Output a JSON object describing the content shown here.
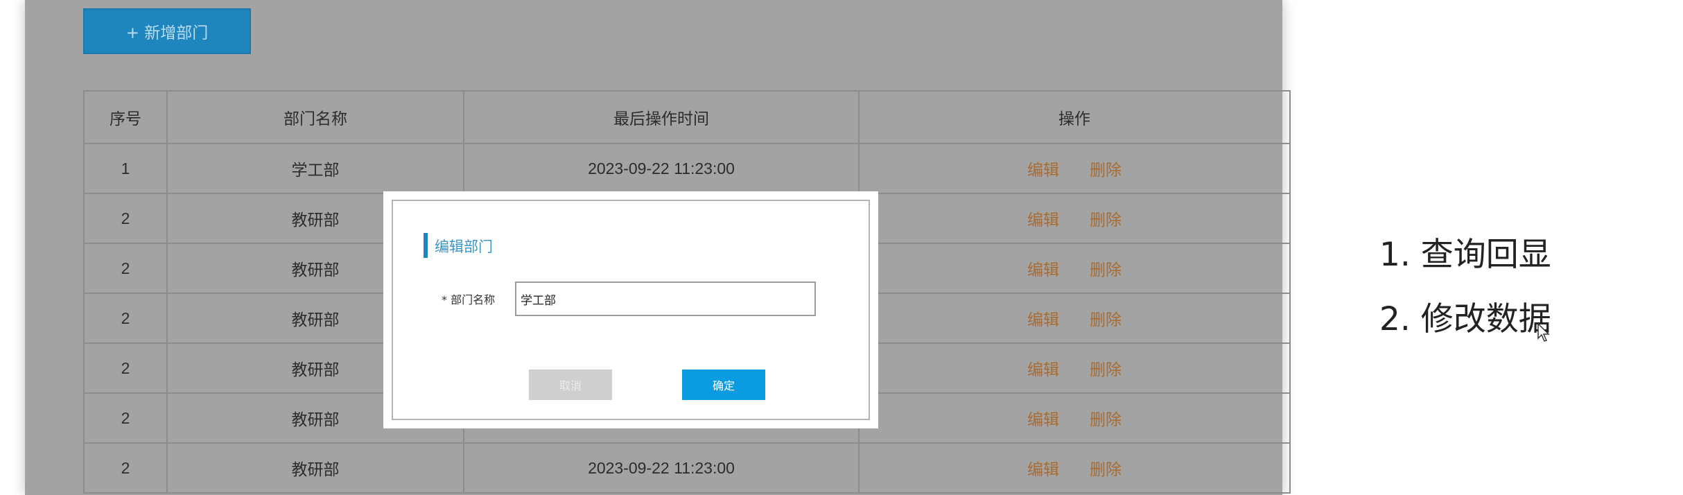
{
  "toolbar": {
    "add_label": "+ 新增部门"
  },
  "table": {
    "headers": [
      "序号",
      "部门名称",
      "最后操作时间",
      "操作"
    ],
    "rows": [
      {
        "index": "1",
        "name": "学工部",
        "time": "2023-09-22 11:23:00",
        "edit": "编辑",
        "delete": "删除"
      },
      {
        "index": "2",
        "name": "教研部",
        "time": "",
        "edit": "编辑",
        "delete": "删除"
      },
      {
        "index": "2",
        "name": "教研部",
        "time": "",
        "edit": "编辑",
        "delete": "删除"
      },
      {
        "index": "2",
        "name": "教研部",
        "time": "",
        "edit": "编辑",
        "delete": "删除"
      },
      {
        "index": "2",
        "name": "教研部",
        "time": "",
        "edit": "编辑",
        "delete": "删除"
      },
      {
        "index": "2",
        "name": "教研部",
        "time": "",
        "edit": "编辑",
        "delete": "删除"
      },
      {
        "index": "2",
        "name": "教研部",
        "time": "2023-09-22 11:23:00",
        "edit": "编辑",
        "delete": "删除"
      }
    ]
  },
  "dialog": {
    "title": "编辑部门",
    "field_label": "* 部门名称",
    "field_value": "学工部",
    "cancel_label": "取消",
    "ok_label": "确定"
  },
  "notes": [
    "1. 查询回显",
    "2. 修改数据"
  ],
  "colors": {
    "accent": "#1f86bd",
    "link": "#a86b33",
    "primary_button": "#0a9be0",
    "mask": "#a3a3a3"
  }
}
